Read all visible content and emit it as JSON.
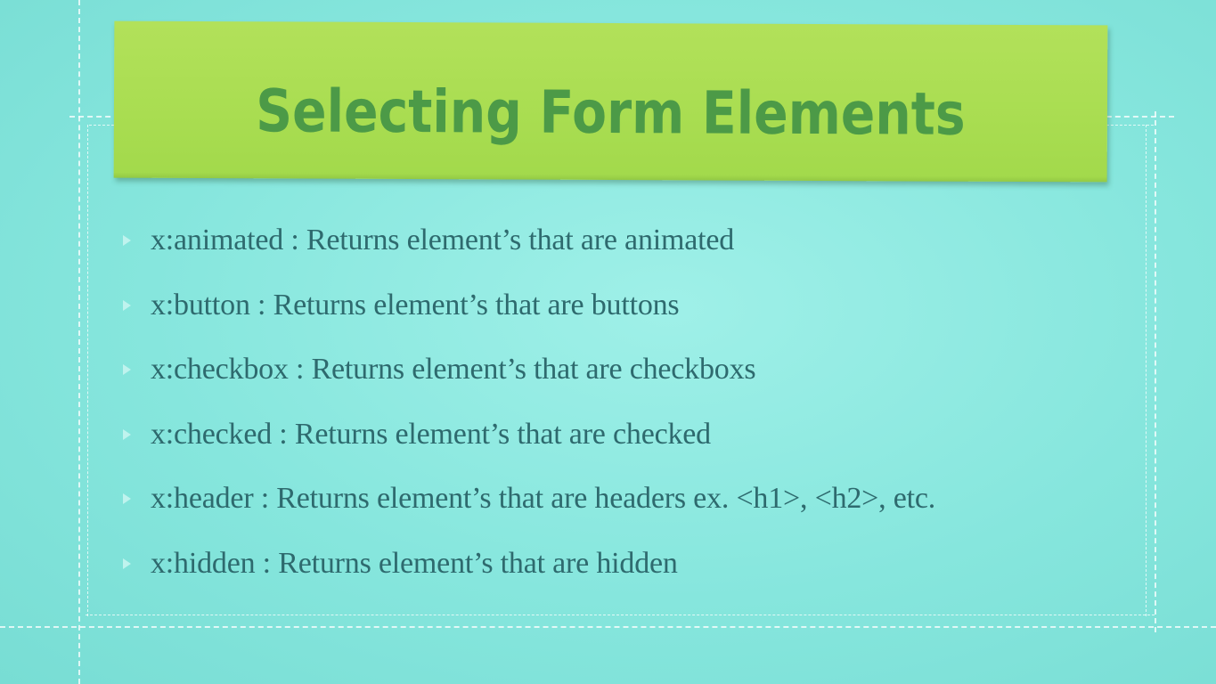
{
  "slide": {
    "title": "Selecting Form Elements",
    "bullets": [
      "x:animated : Returns element’s that are animated",
      "x:button : Returns element’s that are buttons",
      "x:checkbox : Returns element’s that are checkboxs",
      "x:checked : Returns element’s that are checked",
      "x:header : Returns element’s that are headers ex. <h1>, <h2>, etc.",
      "x:hidden : Returns element’s that are hidden"
    ]
  },
  "colors": {
    "background": "#86e6dd",
    "banner": "#a9dd51",
    "title": "#4c9a47",
    "bullet_text": "#2e6a6e",
    "stitching": "#ffffff"
  }
}
